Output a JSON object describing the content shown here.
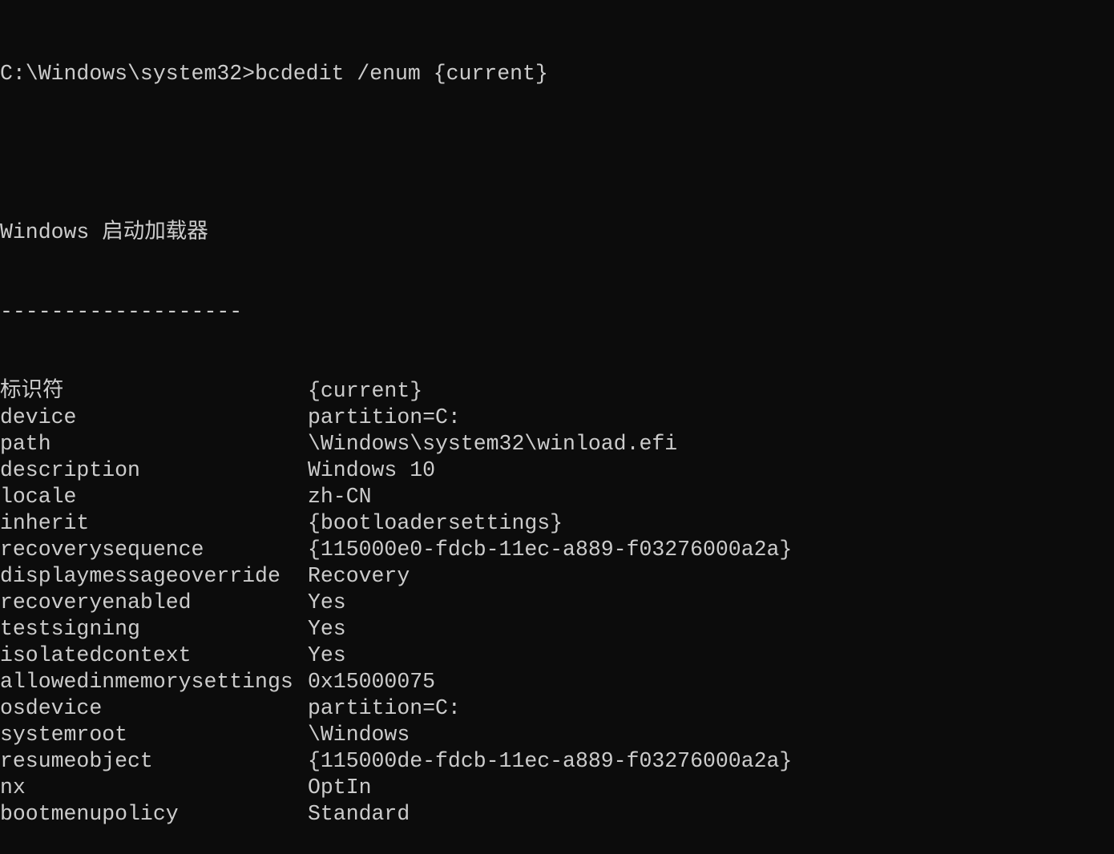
{
  "prompt": "C:\\Windows\\system32>bcdedit /enum {current}",
  "section_title": "Windows 启动加载器",
  "separator": "-------------------",
  "entries": [
    {
      "key": "标识符",
      "value": "{current}"
    },
    {
      "key": "device",
      "value": "partition=C:"
    },
    {
      "key": "path",
      "value": "\\Windows\\system32\\winload.efi"
    },
    {
      "key": "description",
      "value": "Windows 10"
    },
    {
      "key": "locale",
      "value": "zh-CN"
    },
    {
      "key": "inherit",
      "value": "{bootloadersettings}"
    },
    {
      "key": "recoverysequence",
      "value": "{115000e0-fdcb-11ec-a889-f03276000a2a}"
    },
    {
      "key": "displaymessageoverride",
      "value": "Recovery"
    },
    {
      "key": "recoveryenabled",
      "value": "Yes"
    },
    {
      "key": "testsigning",
      "value": "Yes"
    },
    {
      "key": "isolatedcontext",
      "value": "Yes"
    },
    {
      "key": "allowedinmemorysettings",
      "value": "0x15000075"
    },
    {
      "key": "osdevice",
      "value": "partition=C:"
    },
    {
      "key": "systemroot",
      "value": "\\Windows"
    },
    {
      "key": "resumeobject",
      "value": "{115000de-fdcb-11ec-a889-f03276000a2a}"
    },
    {
      "key": "nx",
      "value": "OptIn"
    },
    {
      "key": "bootmenupolicy",
      "value": "Standard"
    }
  ],
  "colors": {
    "background": "#0c0c0c",
    "text": "#cccccc"
  }
}
